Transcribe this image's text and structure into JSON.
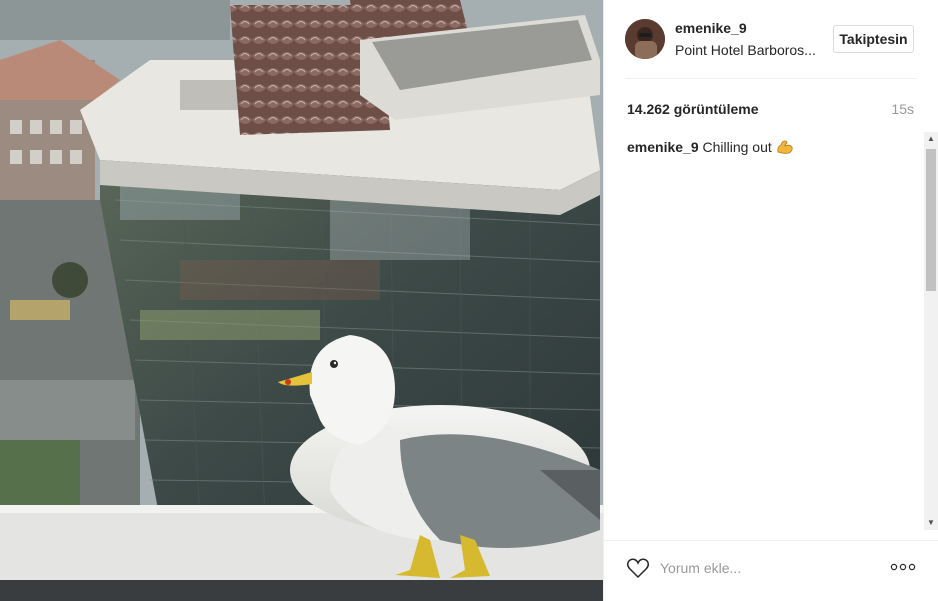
{
  "post": {
    "username": "emenike_9",
    "location": "Point Hotel Barboros...",
    "follow_label": "Takiptesin",
    "views": "14.262 görüntüleme",
    "time": "15s",
    "caption_user": "emenike_9",
    "caption_text": "Chilling out",
    "caption_emoji": "flexed-biceps",
    "comment_placeholder": "Yorum ekle...",
    "media_description": "seagull on window ledge in front of glass office building"
  },
  "icons": {
    "like": "heart-outline-icon",
    "more": "more-options-icon"
  },
  "colors": {
    "text": "#262626",
    "muted": "#999999",
    "border": "#dbdbdb"
  }
}
